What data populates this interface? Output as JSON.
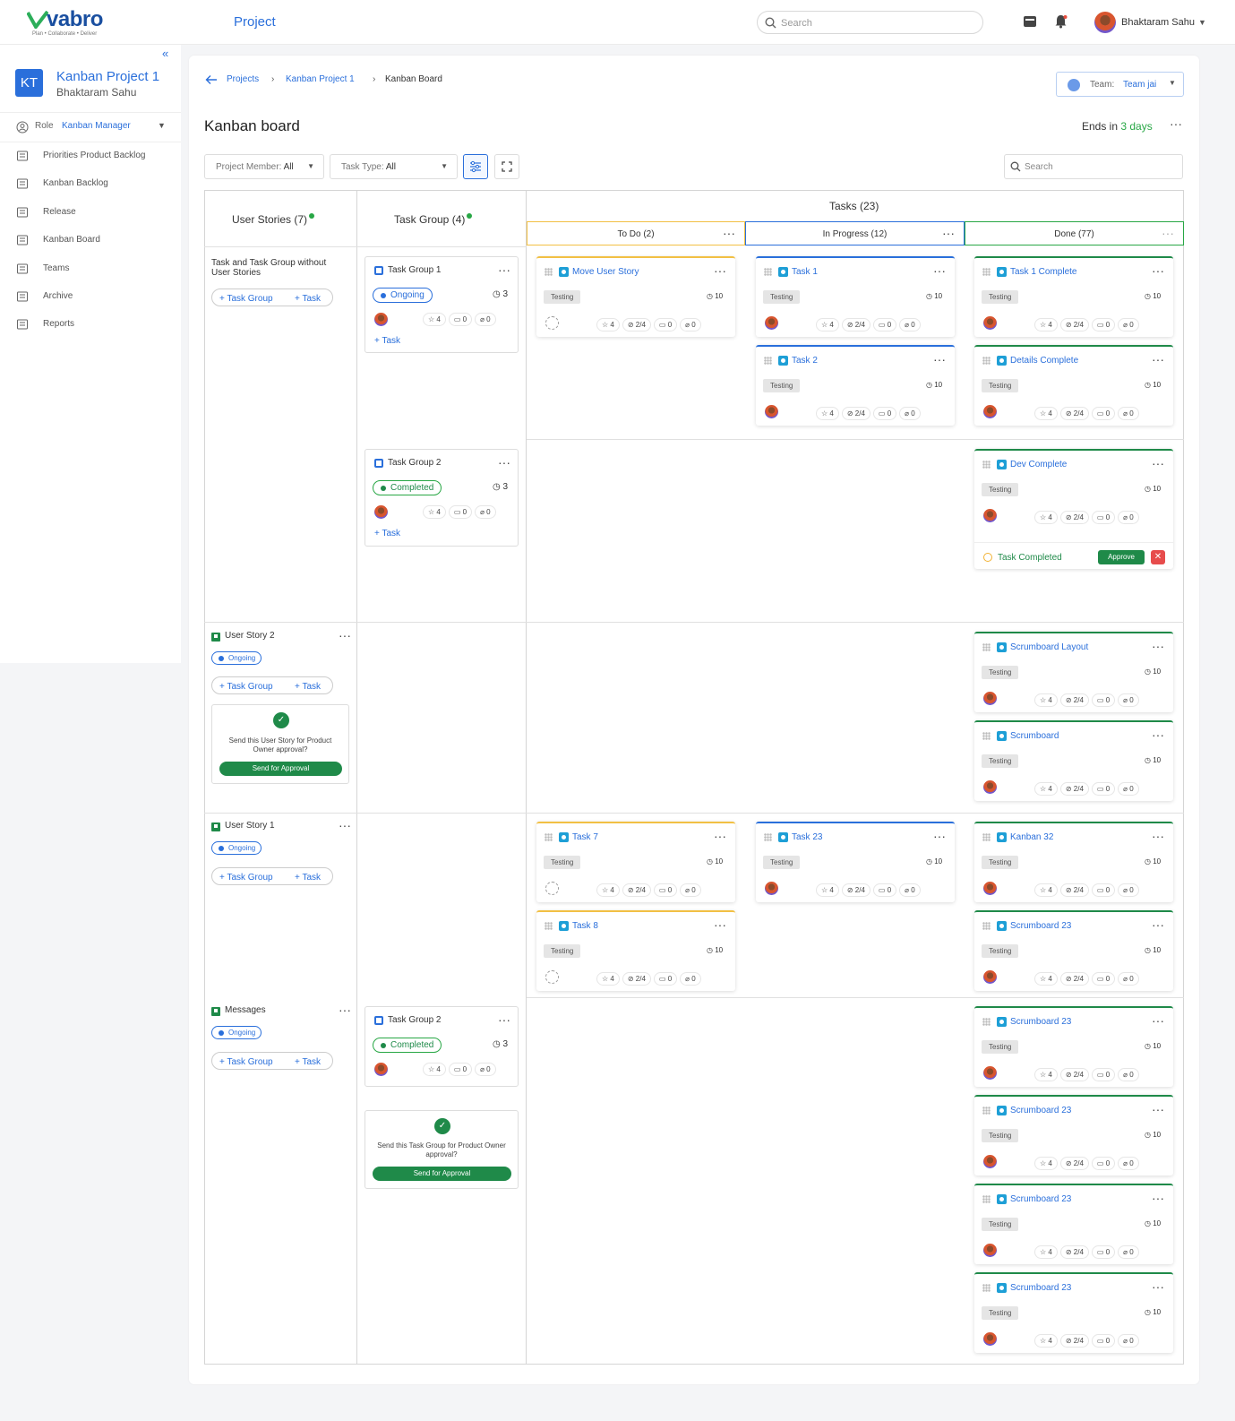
{
  "app": {
    "logo": "vabro",
    "tagline": "Plan • Collaborate • Deliver",
    "section_title": "Project",
    "search_placeholder": "Search",
    "user_name": "Bhaktaram Sahu"
  },
  "sidebar": {
    "project_initials": "KT",
    "project_name": "Kanban Project 1",
    "project_owner": "Bhaktaram Sahu",
    "role_label": "Role",
    "role_value": "Kanban Manager",
    "items": [
      {
        "label": "Priorities Product Backlog",
        "icon": "backlog-priority-icon"
      },
      {
        "label": "Kanban Backlog",
        "icon": "list-icon"
      },
      {
        "label": "Release",
        "icon": "rocket-icon"
      },
      {
        "label": "Kanban Board",
        "icon": "board-icon",
        "active": true
      },
      {
        "label": "Teams",
        "icon": "teams-icon"
      },
      {
        "label": "Archive",
        "icon": "archive-icon"
      },
      {
        "label": "Reports",
        "icon": "reports-icon"
      }
    ]
  },
  "breadcrumb": [
    "Projects",
    "Kanban Project 1",
    "Kanban Board"
  ],
  "team": {
    "label": "Team:",
    "value": "Team jai"
  },
  "page": {
    "title": "Kanban board",
    "ends_prefix": "Ends in",
    "ends_days": "3 days"
  },
  "filters": {
    "member_label": "Project Member:",
    "member_value": "All",
    "type_label": "Task Type:",
    "type_value": "All",
    "search_placeholder": "Search"
  },
  "columns": {
    "user_stories": "User Stories (7)",
    "task_group": "Task Group (4)",
    "tasks": "Tasks (23)",
    "todo": "To Do (2)",
    "in_progress": "In Progress (12)",
    "done": "Done (77)"
  },
  "rows": [
    {
      "title": "Task and Task Group without User Stories",
      "add_group": "Task Group",
      "add_task": "Task"
    },
    {
      "title": "User Story 2",
      "status": "Ongoing",
      "add_group": "Task Group",
      "add_task": "Task",
      "approval_text": "Send this User Story for Product Owner approval?",
      "approval_btn": "Send for Approval"
    },
    {
      "title": "User Story 1",
      "status": "Ongoing",
      "add_group": "Task Group",
      "add_task": "Task"
    },
    {
      "title": "Messages",
      "status": "Ongoing",
      "add_group": "Task Group",
      "add_task": "Task"
    }
  ],
  "task_groups": [
    {
      "title": "Task Group 1",
      "status": "Ongoing",
      "count": "3",
      "stars": "4",
      "comments": "0",
      "attach": "0",
      "add": "Task"
    },
    {
      "title": "Task Group 2",
      "status": "Completed",
      "count": "3",
      "stars": "4",
      "comments": "0",
      "attach": "0",
      "add": "Task"
    },
    {
      "title": "Task Group 2",
      "status": "Completed",
      "count": "3",
      "stars": "4",
      "comments": "0",
      "attach": "0"
    }
  ],
  "tg_approval": {
    "text": "Send this Task Group for Product Owner approval?",
    "btn": "Send for Approval"
  },
  "task_meta": {
    "tag": "Testing",
    "estimate": "10",
    "stars": "4",
    "subtasks": "2/4",
    "comments": "0",
    "attachments": "0"
  },
  "task_complete": {
    "label": "Task Completed",
    "approve": "Approve",
    "reject": "✕"
  },
  "tasks": {
    "todo": [
      "Move User Story",
      "Task 7",
      "Task 8"
    ],
    "progress": [
      "Task 1",
      "Task 2",
      "Task 23"
    ],
    "done": [
      "Task 1 Complete",
      "Details Complete",
      "Dev Complete",
      "Scrumboard Layout",
      "Scrumboard",
      "Kanban 32",
      "Scrumboard 23",
      "Scrumboard 23",
      "Scrumboard 23",
      "Scrumboard 23",
      "Scrumboard 23"
    ]
  }
}
